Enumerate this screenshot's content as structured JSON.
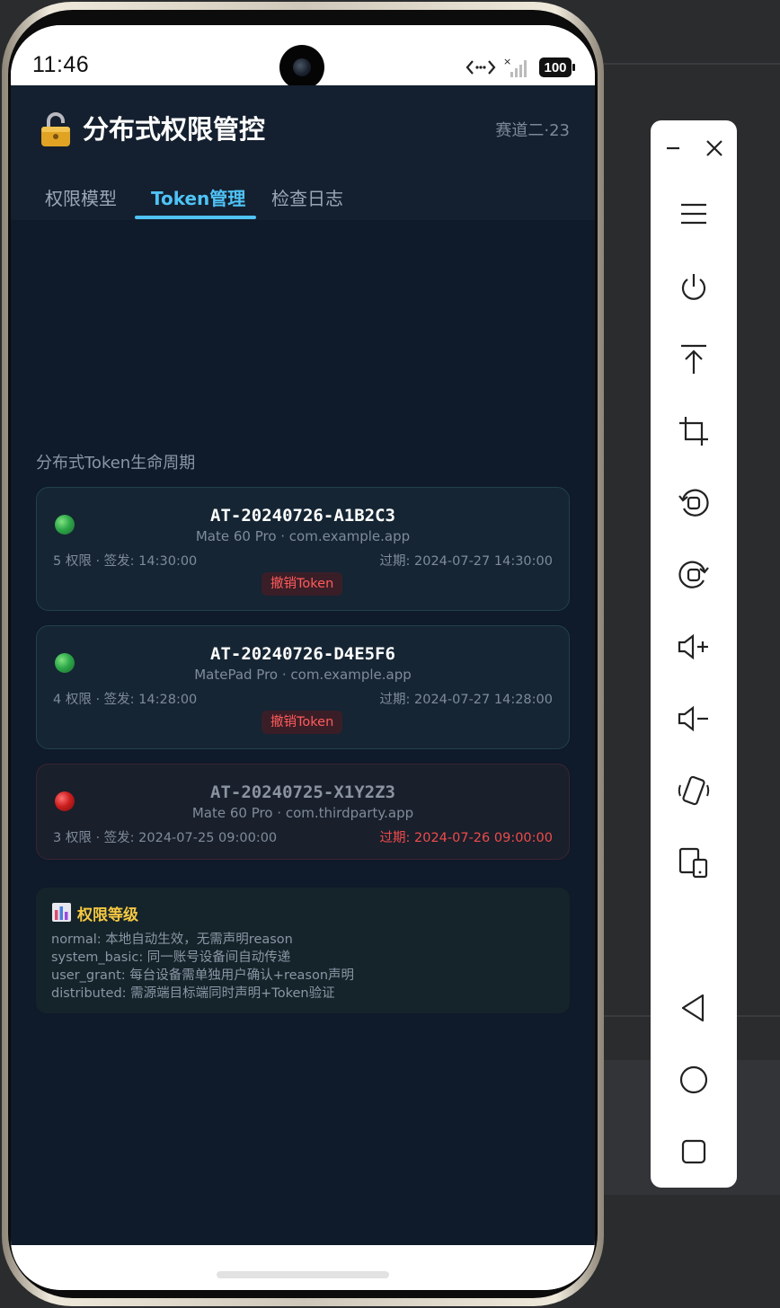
{
  "status_bar": {
    "time": "11:46",
    "battery": "100"
  },
  "header": {
    "title": "分布式权限管控",
    "track": "赛道二·23"
  },
  "tabs": [
    {
      "label": "权限模型",
      "active": false
    },
    {
      "label": "Token管理",
      "active": true
    },
    {
      "label": "检查日志",
      "active": false
    }
  ],
  "section_title": "分布式Token生命周期",
  "tokens": [
    {
      "id": "AT-20240726-A1B2C3",
      "device_app": "Mate 60 Pro · com.example.app",
      "meta": "5 权限 · 签发: 14:30:00",
      "expiry": "过期: 2024-07-27 14:30:00",
      "status": "active",
      "action": "撤销Token"
    },
    {
      "id": "AT-20240726-D4E5F6",
      "device_app": "MatePad Pro · com.example.app",
      "meta": "4 权限 · 签发: 14:28:00",
      "expiry": "过期: 2024-07-27 14:28:00",
      "status": "active",
      "action": "撤销Token"
    },
    {
      "id": "AT-20240725-X1Y2Z3",
      "device_app": "Mate 60 Pro · com.thirdparty.app",
      "meta": "3 权限 · 签发: 2024-07-25 09:00:00",
      "expiry": "过期: 2024-07-26 09:00:00",
      "status": "expired"
    }
  ],
  "levels": {
    "title": "权限等级",
    "lines": [
      "normal: 本地自动生效，无需声明reason",
      "system_basic: 同一账号设备间自动传递",
      "user_grant: 每台设备需单独用户确认+reason声明",
      "distributed: 需源端目标端同时声明+Token验证"
    ]
  },
  "colors": {
    "background": "#0f1a2a",
    "accent": "#4fc3f7",
    "danger": "#ef4b4b",
    "warning_title": "#f5c842"
  },
  "toolbar_icons": [
    "minimize-icon",
    "close-icon",
    "menu-icon",
    "power-icon",
    "top-icon",
    "crop-icon",
    "rotate-left-icon",
    "rotate-right-icon",
    "volume-up-icon",
    "volume-down-icon",
    "shake-icon",
    "multi-device-icon",
    "back-icon",
    "home-icon",
    "recents-icon"
  ]
}
